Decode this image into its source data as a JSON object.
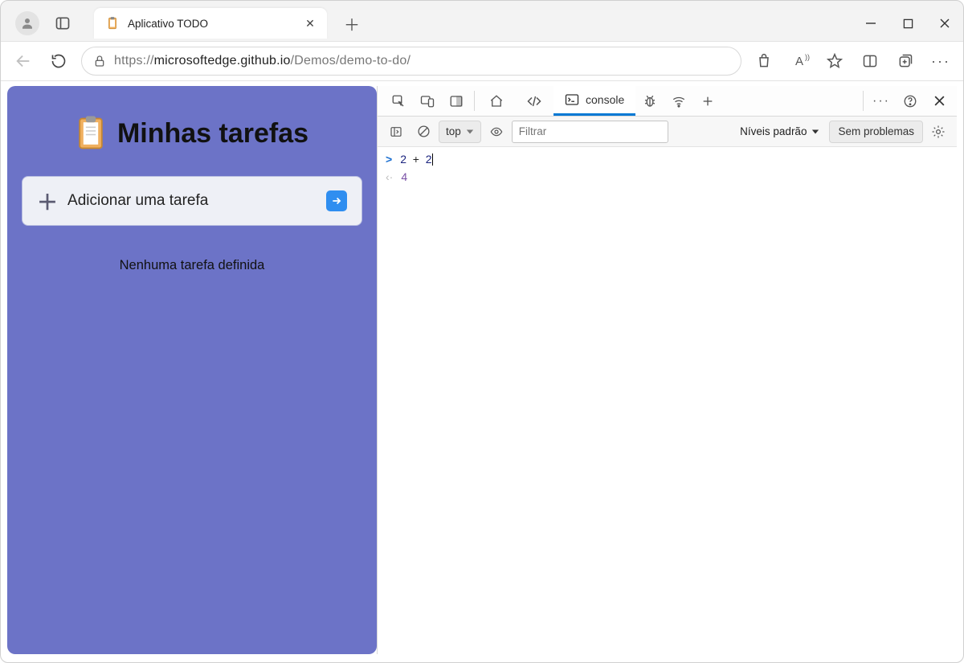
{
  "tab": {
    "title": "Aplicativo TODO"
  },
  "url": {
    "host": "microsoftedge.github.io",
    "path": "/Demos/demo-to-do/",
    "prefix": "https://"
  },
  "app": {
    "title": "Minhas tarefas",
    "add_label": "Adicionar uma tarefa",
    "empty": "Nenhuma tarefa definida"
  },
  "devtools": {
    "active_tab": "console",
    "context": "top",
    "filter_placeholder": "Filtrar",
    "levels_label": "Níveis padrão",
    "issues_label": "Sem problemas",
    "input_expr": {
      "a": "2",
      "op": "+",
      "b": "2"
    },
    "output": "4"
  }
}
